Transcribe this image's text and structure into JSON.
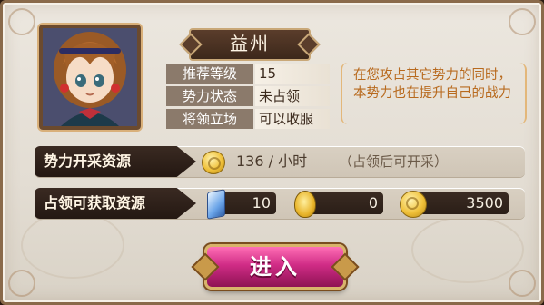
{
  "territory": {
    "name": "益州",
    "info": [
      {
        "label": "推荐等级",
        "value": "15"
      },
      {
        "label": "势力状态",
        "value": "未占领"
      },
      {
        "label": "将领立场",
        "value": "可以收服"
      }
    ],
    "description": "在您攻占其它势力的同时，本势力也在提升自己的战力"
  },
  "mining": {
    "label": "势力开采资源",
    "rate": "136 / 小时",
    "note": "（占领后可开采）"
  },
  "occupy": {
    "label": "占领可获取资源",
    "resources": [
      {
        "icon": "crystal-icon",
        "value": "10"
      },
      {
        "icon": "token-icon",
        "value": "0"
      },
      {
        "icon": "gold-coin-icon",
        "value": "3500"
      }
    ]
  },
  "enter_button": {
    "label": "进入"
  },
  "colors": {
    "accent": "#d02c86",
    "description_text": "#b86a1e",
    "label_bar": "#2a1e17"
  }
}
